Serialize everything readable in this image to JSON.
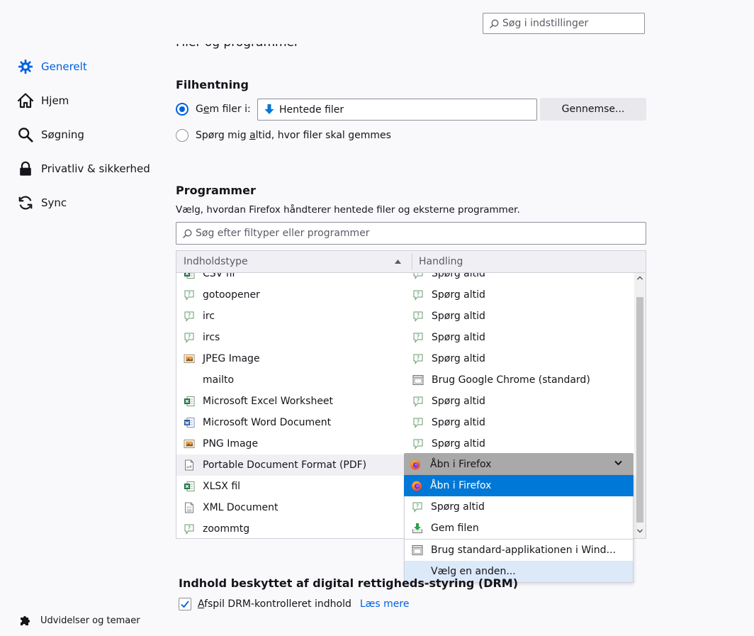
{
  "search": {
    "placeholder": "Søg i indstillinger"
  },
  "sidebar": {
    "items": [
      {
        "label": "Generelt",
        "icon": "gear-icon",
        "selected": true
      },
      {
        "label": "Hjem",
        "icon": "home-icon"
      },
      {
        "label": "Søgning",
        "icon": "search-icon"
      },
      {
        "label": "Privatliv & sikkerhed",
        "icon": "lock-icon"
      },
      {
        "label": "Sync",
        "icon": "sync-icon"
      }
    ],
    "extensions_label": "Udvidelser og temaer"
  },
  "cut_header": "Filer og programmer",
  "downloads": {
    "heading": "Filhentning",
    "save_label_pre": "G",
    "save_label_accel": "e",
    "save_label_post": "m filer i:",
    "path": "Hentede filer",
    "browse_label": "Gennemse...",
    "ask_label_pre": "Spørg mig ",
    "ask_label_accel": "a",
    "ask_label_post": "ltid, hvor filer skal gemmes"
  },
  "applications": {
    "heading": "Programmer",
    "description": "Vælg, hvordan Firefox håndterer hentede filer og eksterne programmer.",
    "search_placeholder": "Søg efter filtyper eller programmer",
    "col_type": "Indholdstype",
    "col_action": "Handling",
    "rows": [
      {
        "type": "CSV fil",
        "type_icon": "excel-file-icon",
        "action": "Spørg altid",
        "action_icon": "ask-icon"
      },
      {
        "type": "gotoopener",
        "type_icon": "ask-icon",
        "action": "Spørg altid",
        "action_icon": "ask-icon"
      },
      {
        "type": "irc",
        "type_icon": "ask-icon",
        "action": "Spørg altid",
        "action_icon": "ask-icon"
      },
      {
        "type": "ircs",
        "type_icon": "ask-icon",
        "action": "Spørg altid",
        "action_icon": "ask-icon"
      },
      {
        "type": "JPEG Image",
        "type_icon": "image-file-icon",
        "action": "Spørg altid",
        "action_icon": "ask-icon"
      },
      {
        "type": "mailto",
        "type_icon": "",
        "action": "Brug Google Chrome (standard)",
        "action_icon": "app-window-icon"
      },
      {
        "type": "Microsoft Excel Worksheet",
        "type_icon": "excel-file-icon",
        "action": "Spørg altid",
        "action_icon": "ask-icon"
      },
      {
        "type": "Microsoft Word Document",
        "type_icon": "word-file-icon",
        "action": "Spørg altid",
        "action_icon": "ask-icon"
      },
      {
        "type": "PNG Image",
        "type_icon": "image-file-icon",
        "action": "Spørg altid",
        "action_icon": "ask-icon"
      },
      {
        "type": "Portable Document Format (PDF)",
        "type_icon": "pdf-file-icon",
        "action": "",
        "action_icon": ""
      },
      {
        "type": "XLSX fil",
        "type_icon": "excel-file-icon",
        "action": "",
        "action_icon": ""
      },
      {
        "type": "XML Document",
        "type_icon": "xml-file-icon",
        "action": "",
        "action_icon": ""
      },
      {
        "type": "zoommtg",
        "type_icon": "ask-icon",
        "action": "",
        "action_icon": ""
      }
    ],
    "selected_action": "Åbn i Firefox",
    "dropdown_options": [
      {
        "label": "Åbn i Firefox",
        "icon": "firefox-icon",
        "highlighted": true
      },
      {
        "label": "Spørg altid",
        "icon": "ask-icon"
      },
      {
        "label": "Gem filen",
        "icon": "save-file-icon"
      },
      {
        "label": "Brug standard-applikationen i  Wind...",
        "icon": "app-window-icon"
      },
      {
        "label": "Vælg en anden...",
        "icon": "",
        "hover": true
      }
    ]
  },
  "drm": {
    "heading": "Indhold beskyttet af digital rettigheds-styring (DRM)",
    "checkbox_label_accel": "A",
    "checkbox_label_rest": "fspil DRM-kontrolleret indhold",
    "checked": true,
    "learn_more": "Læs mere"
  },
  "colors": {
    "accent": "#0061e0",
    "highlight": "#0078d7",
    "hover": "#dbe9f9",
    "background": "#f9f9fb"
  }
}
